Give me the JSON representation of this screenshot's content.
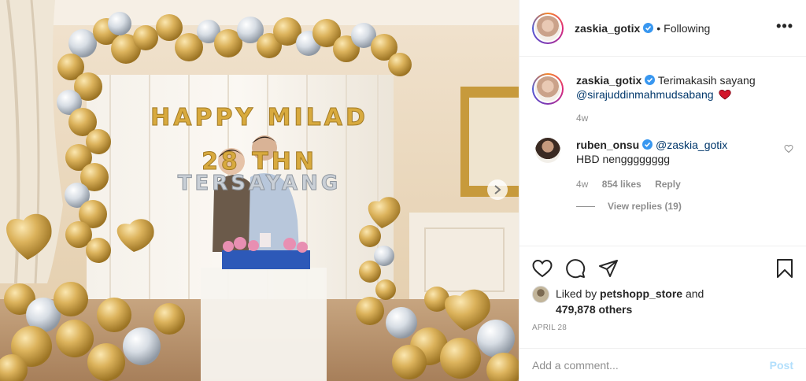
{
  "post": {
    "photo_banner": {
      "line1": "HAPPY MILAD",
      "line2": "28 THN",
      "line3": "TERSAYANG"
    }
  },
  "header": {
    "username": "zaskia_gotix",
    "separator": "•",
    "follow_status": "Following",
    "more_label": "•••"
  },
  "caption": {
    "username": "zaskia_gotix",
    "text": "Terimakasih sayang",
    "mention": "@sirajuddinmahmudsabang",
    "time": "4w"
  },
  "comment": {
    "username": "ruben_onsu",
    "mention": "@zaskia_gotix",
    "text": "HBD nengggggggg",
    "time": "4w",
    "likes": "854 likes",
    "reply": "Reply",
    "view_replies": "View replies (19)"
  },
  "likes": {
    "prefix": "Liked by",
    "user": "petshopp_store",
    "and": "and",
    "others": "479,878 others"
  },
  "date": "APRIL 28",
  "add_comment": {
    "placeholder": "Add a comment...",
    "post_label": "Post"
  },
  "colors": {
    "verified": "#3897f0",
    "heart": "#ed4956",
    "post_disabled": "#b2dffc",
    "mention": "#00376b",
    "balloon_gold": "#d4a74a",
    "balloon_silver": "#d7dde4"
  },
  "icons": [
    "heart-icon",
    "comment-icon",
    "share-icon",
    "bookmark-icon",
    "verified-icon",
    "chevron-right-icon"
  ]
}
